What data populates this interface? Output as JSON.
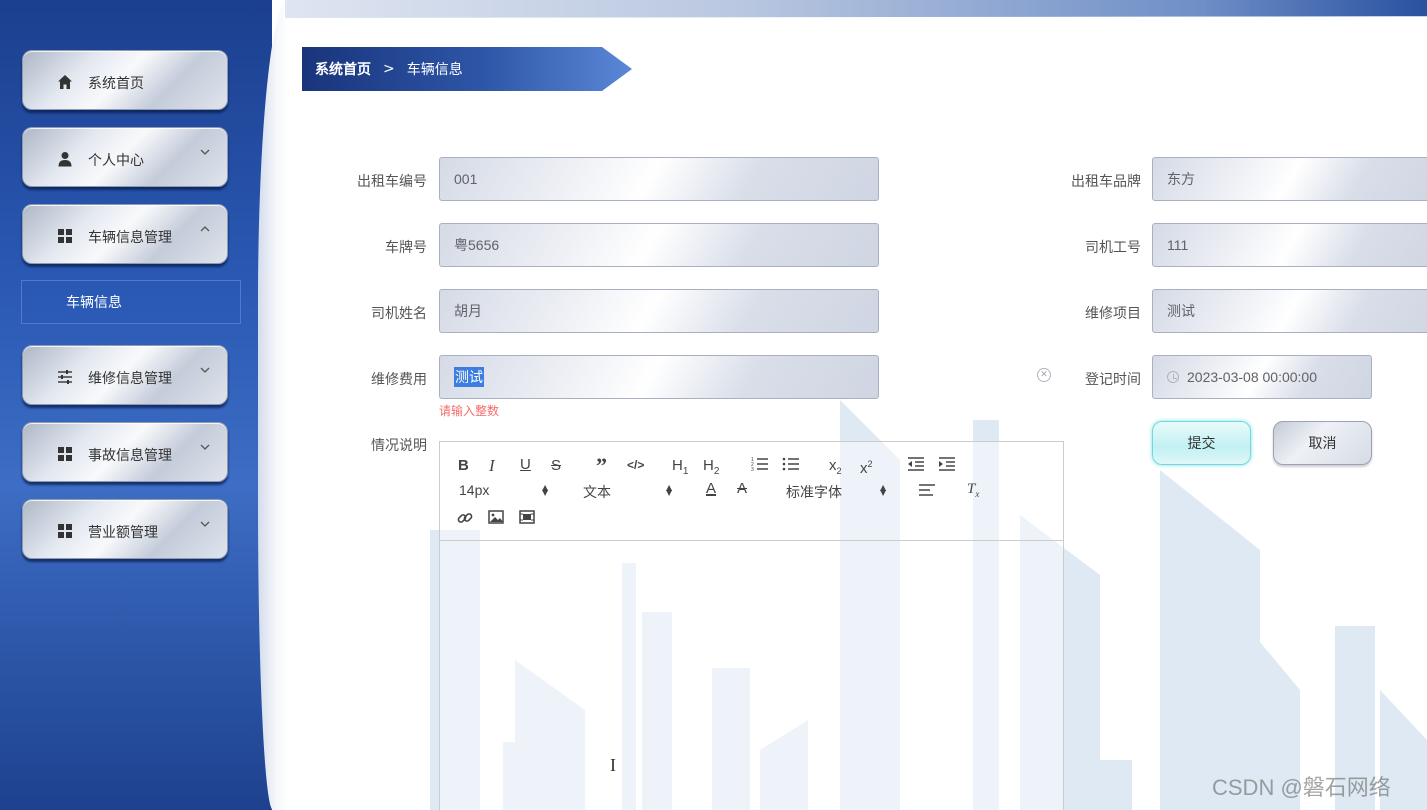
{
  "sidebar": {
    "items": [
      {
        "label": "系统首页",
        "icon": "home-icon",
        "chevron": ""
      },
      {
        "label": "个人中心",
        "icon": "user-icon",
        "chevron": "⌄"
      },
      {
        "label": "车辆信息管理",
        "icon": "grid-icon",
        "chevron": "⌃"
      },
      {
        "label": "维修信息管理",
        "icon": "sliders-icon",
        "chevron": "⌄"
      },
      {
        "label": "事故信息管理",
        "icon": "grid-icon",
        "chevron": "⌄"
      },
      {
        "label": "营业额管理",
        "icon": "grid-icon",
        "chevron": "⌄"
      }
    ],
    "submenu": {
      "label": "车辆信息"
    }
  },
  "breadcrumb": {
    "home": "系统首页",
    "separator": ">",
    "current": "车辆信息"
  },
  "form": {
    "taxi_no": {
      "label": "出租车编号",
      "value": "001"
    },
    "taxi_brand": {
      "label": "出租车品牌",
      "value": "东方"
    },
    "plate_no": {
      "label": "车牌号",
      "value": "粤5656"
    },
    "driver_id": {
      "label": "司机工号",
      "value": "111"
    },
    "driver_name": {
      "label": "司机姓名",
      "value": "胡月"
    },
    "repair_item": {
      "label": "维修项目",
      "value": "测试"
    },
    "repair_cost": {
      "label": "维修费用",
      "value": "测试",
      "error": "请输入整数"
    },
    "register_time": {
      "label": "登记时间",
      "value": "2023-03-08 00:00:00"
    },
    "description": {
      "label": "情况说明"
    }
  },
  "editor": {
    "font_size": "14px",
    "header_select": "文本",
    "font_family": "标准字体"
  },
  "buttons": {
    "submit": "提交",
    "cancel": "取消"
  },
  "watermark": "CSDN @磐石网络",
  "colors": {
    "sidebar": "#2a59b4",
    "breadcrumb": "#19347b",
    "error": "#f56c6c",
    "submit": "#c2f0f2"
  }
}
